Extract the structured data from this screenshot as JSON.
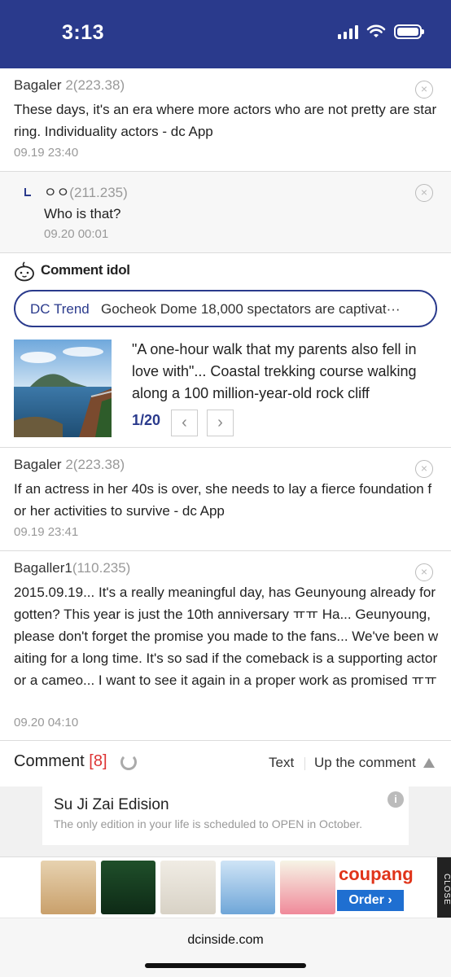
{
  "status_bar": {
    "time": "3:13"
  },
  "comments": [
    {
      "author": "Bagaler",
      "ip": " 2(223.38)",
      "body": "These days, it's an era where more actors who are not pretty are starring. Individuality actors - dc App",
      "date": "09.19 23:40"
    },
    {
      "author": "ㅇㅇ",
      "ip": "(211.235)",
      "body": "Who is that?",
      "date": "09.20 00:01",
      "is_reply": true
    },
    {
      "author": "Bagaler",
      "ip": " 2(223.38)",
      "body": "If an actress in her 40s is over, she needs to lay a fierce foundation for her activities to survive - dc App",
      "date": "09.19 23:41"
    },
    {
      "author": "Bagaller1",
      "ip": "(110.235)",
      "body": "2015.09.19... It's a really meaningful day, has Geunyoung already forgotten? This year is just the 10th anniversary ㅠㅠ Ha... Geunyoung, please don't forget the promise you made to the fans... We've been waiting for a long time. It's so sad if the comeback is a supporting actor or a cameo... I want to see it again in a proper work as promised ㅠㅠ",
      "date": "09.20 04:10"
    }
  ],
  "delete_icon_glyph": "×",
  "comment_idol": {
    "title": "Comment idol",
    "trend_label": "DC Trend",
    "trend_text": "Gocheok Dome 18,000 spectators are captivat···",
    "card_title": "\"A one-hour walk that my parents also fell in love with\"... Coastal trekking course walking along a 100 million-year-old rock cliff",
    "pager": "1/20",
    "prev_glyph": "‹",
    "next_glyph": "›"
  },
  "comment_bar": {
    "title": "Comment",
    "count": "[8]",
    "text_label": "Text",
    "up_label": "Up the comment"
  },
  "ad": {
    "title": "Su Ji Zai Edision",
    "desc": "The only edition in your life is scheduled to OPEN in October.",
    "info_glyph": "i"
  },
  "banner": {
    "brand": "coupang",
    "order_label": "Order ›",
    "close_label": "CLOSE"
  },
  "browser": {
    "url": "dcinside.com"
  },
  "colors": {
    "brand_navy": "#2a3a8c",
    "count_red": "#d33",
    "coupang_red": "#e0341a",
    "order_blue": "#1f6fd1"
  }
}
